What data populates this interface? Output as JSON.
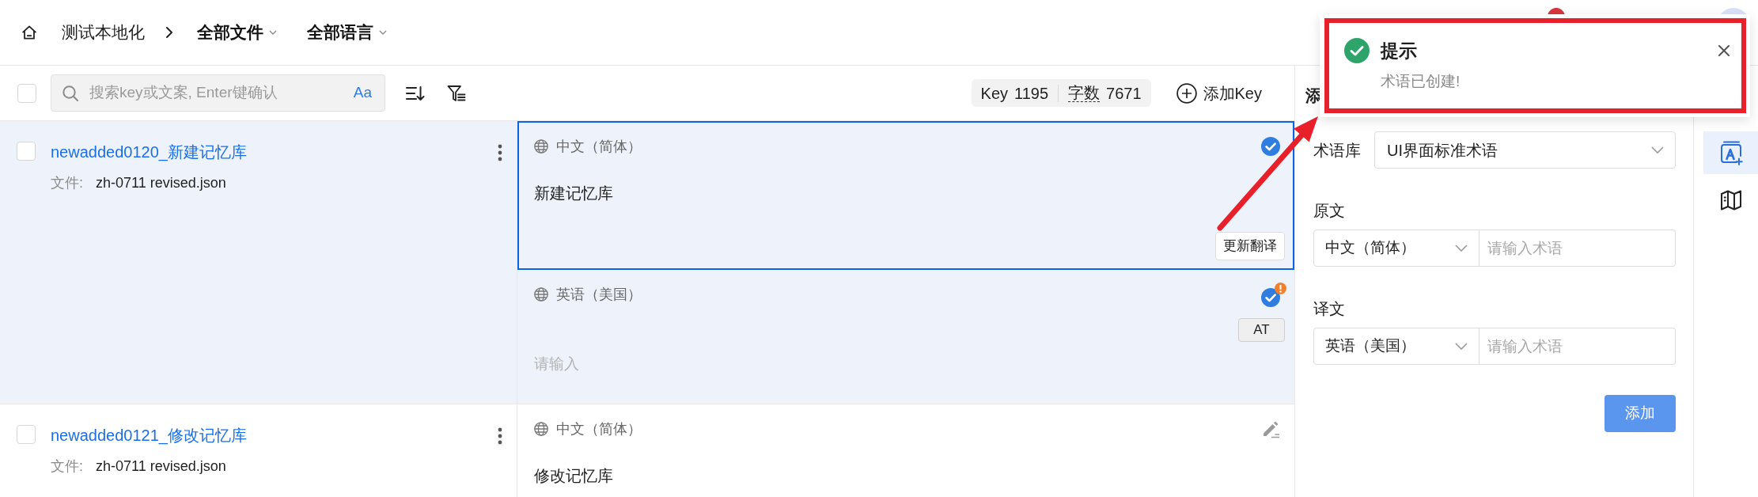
{
  "header": {
    "project": "测试本地化",
    "filters": [
      {
        "label": "全部文件"
      },
      {
        "label": "全部语言"
      }
    ]
  },
  "toolbar": {
    "select_all": {
      "checked": false
    },
    "search": {
      "placeholder": "搜索key或文案, Enter键确认",
      "case_toggle": "Aa"
    },
    "stats": [
      {
        "kind": "keys",
        "label": "Key",
        "value": "1195"
      },
      {
        "kind": "characters",
        "label": "字数",
        "value": "7671"
      }
    ],
    "add_key": "添加Key"
  },
  "entries": [
    {
      "key": "newadded0120_新建记忆库",
      "checked": false,
      "selected": true,
      "file_label": "文件:",
      "file": "zh-0711 revised.json",
      "translations": [
        {
          "language": "中文（简体）",
          "confirmed": true,
          "warning": false,
          "selected": true,
          "text": "新建记忆库",
          "action": {
            "kind": "update",
            "label": "更新翻译"
          }
        },
        {
          "language": "英语（美国）",
          "confirmed": true,
          "warning": true,
          "selected": false,
          "placeholder": "请输入",
          "action": {
            "kind": "auto",
            "label": "AT"
          }
        }
      ]
    },
    {
      "key": "newadded0121_修改记忆库",
      "checked": false,
      "selected": false,
      "file_label": "文件:",
      "file": "zh-0711 revised.json",
      "translations": [
        {
          "language": "中文（简体）",
          "confirmed": false,
          "warning": false,
          "selected": false,
          "text": "修改记忆库"
        }
      ]
    }
  ],
  "term_panel": {
    "title": "添",
    "library_label": "术语库",
    "library": "UI界面标准术语",
    "source_label": "原文",
    "source_language": "中文（简体）",
    "source_placeholder": "请输入术语",
    "target_label": "译文",
    "target_language": "英语（美国）",
    "target_placeholder": "请输入术语",
    "submit": "添加"
  },
  "side_rail": [
    {
      "kind": "termbase",
      "selected": true
    },
    {
      "kind": "map",
      "selected": false
    }
  ],
  "toast": {
    "kind": "success",
    "title": "提示",
    "message": "术语已创建!"
  },
  "annotation": {
    "frame": true,
    "arrow": true
  }
}
